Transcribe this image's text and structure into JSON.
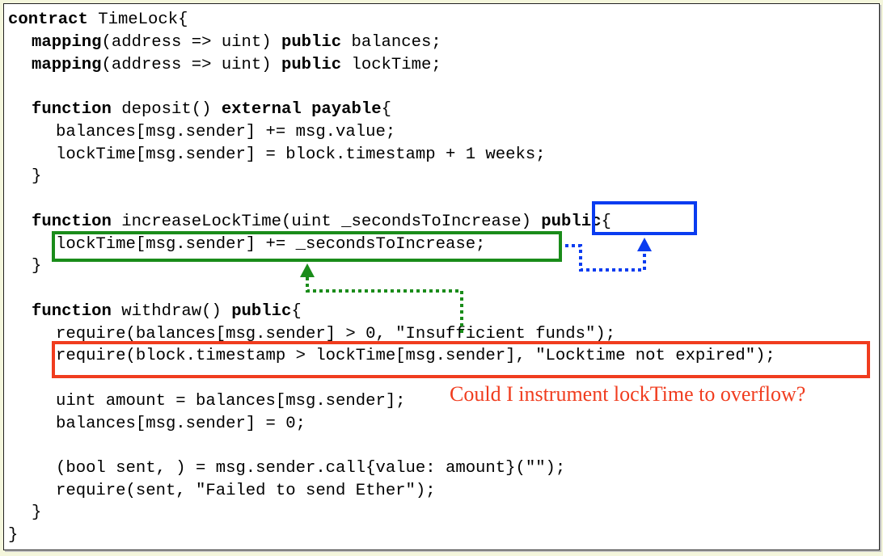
{
  "code": {
    "l1_kw": "contract",
    "l1_rest": " TimeLock{",
    "l2_kw": "mapping",
    "l2_mid": "(address => uint) ",
    "l2_kw2": "public",
    "l2_rest": " balances;",
    "l3_kw": "mapping",
    "l3_mid": "(address => uint) ",
    "l3_kw2": "public",
    "l3_rest": " lockTime;",
    "l4_kw": "function",
    "l4_mid": " deposit() ",
    "l4_kw2": "external",
    "l4_sp": " ",
    "l4_kw3": "payable",
    "l4_rest": "{",
    "l5": "balances[msg.sender] += msg.value;",
    "l6": "lockTime[msg.sender] = block.timestamp + 1 weeks;",
    "l7": "}",
    "l8_kw": "function",
    "l8_mid": " increaseLockTime(uint _secondsToIncrease) ",
    "l8_kw2": "public",
    "l8_rest": "{",
    "l9": "lockTime[msg.sender] += _secondsToIncrease;",
    "l10": "}",
    "l11_kw": "function",
    "l11_mid": " withdraw() ",
    "l11_kw2": "public",
    "l11_rest": "{",
    "l12": "require(balances[msg.sender] > 0, \"Insufficient funds\");",
    "l13": "require(block.timestamp > lockTime[msg.sender], \"Locktime not expired\");",
    "l14": "uint amount = balances[msg.sender];",
    "l15": "balances[msg.sender] = 0;",
    "l16": "(bool sent, ) = msg.sender.call{value: amount}(\"\");",
    "l17": "require(sent, \"Failed to send Ether\");",
    "l18": "}",
    "l19": "}"
  },
  "annotation": {
    "question": "Could I instrument lockTime to overflow?"
  },
  "colors": {
    "green": "#1a8c1a",
    "blue": "#0a3cf0",
    "red": "#f03c1e"
  }
}
